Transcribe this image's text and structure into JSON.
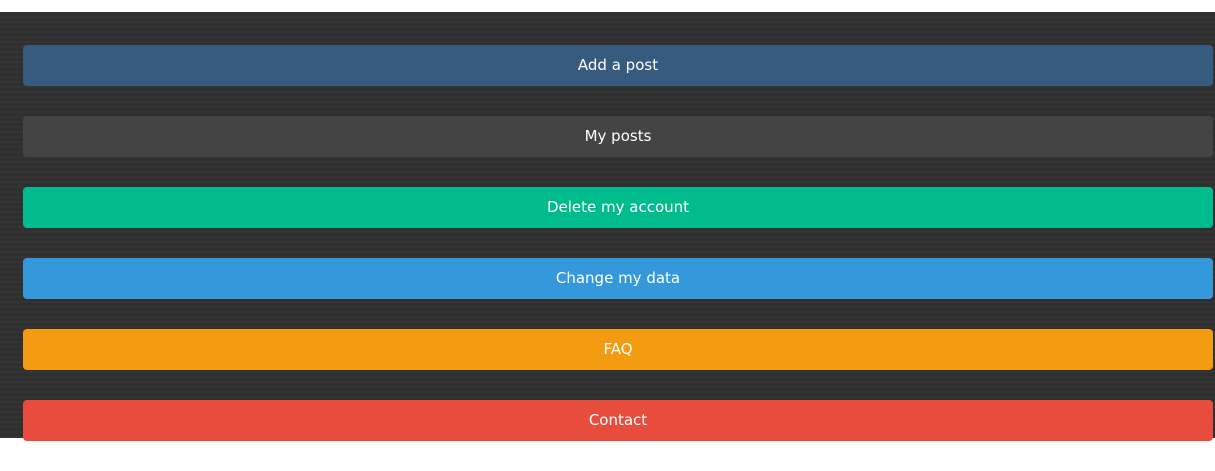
{
  "menu": {
    "buttons": [
      {
        "label": "Add a post",
        "color": "#375a7f"
      },
      {
        "label": "My posts",
        "color": "#444444"
      },
      {
        "label": "Delete my account",
        "color": "#00bc8c"
      },
      {
        "label": "Change my data",
        "color": "#3498db"
      },
      {
        "label": "FAQ",
        "color": "#f39c12"
      },
      {
        "label": "Contact",
        "color": "#e74c3c"
      }
    ]
  }
}
